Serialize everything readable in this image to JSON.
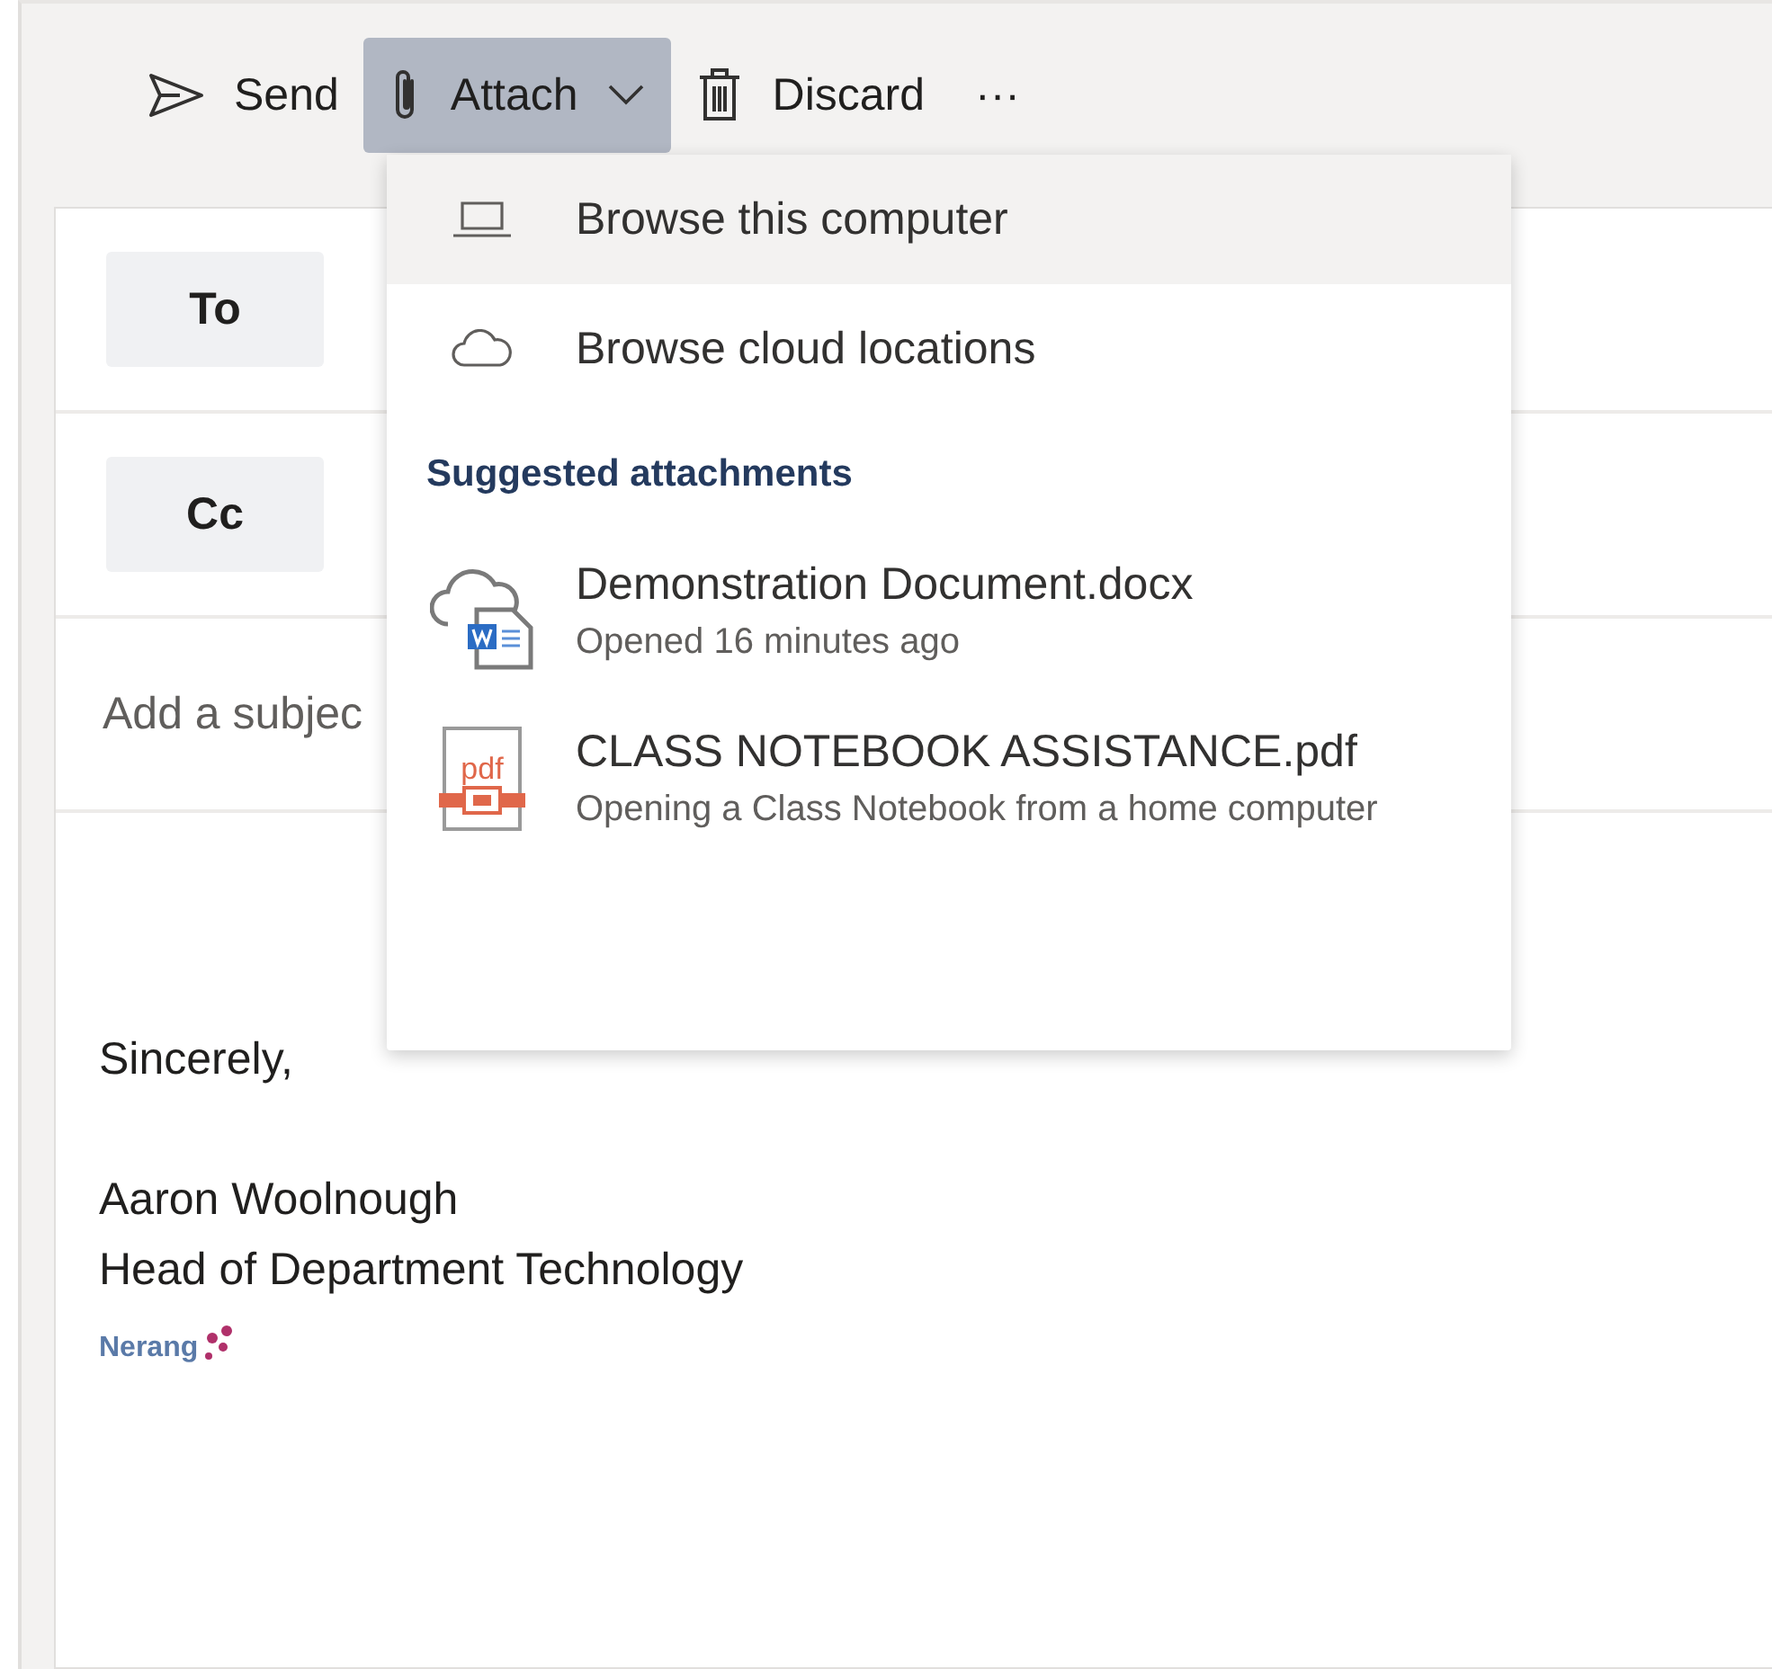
{
  "toolbar": [
    {
      "kind": "send",
      "label": "Send",
      "expanded": false
    },
    {
      "kind": "attach",
      "label": "Attach",
      "expanded": true
    },
    {
      "kind": "discard",
      "label": "Discard",
      "expanded": false
    },
    {
      "kind": "more",
      "label": "···",
      "expanded": false
    }
  ],
  "recipients": [
    {
      "label": "To"
    },
    {
      "label": "Cc"
    }
  ],
  "subject": {
    "placeholder": "Add a subjec"
  },
  "body": {
    "closing": "Sincerely,",
    "name": "Aaron Woolnough",
    "title": "Head of Department Technology",
    "logo_text": "Nerang"
  },
  "attach_menu": {
    "items": [
      {
        "kind": "computer",
        "label": "Browse this computer",
        "selected": true
      },
      {
        "kind": "cloud",
        "label": "Browse cloud locations",
        "selected": false
      }
    ],
    "suggested_heading": "Suggested attachments",
    "suggested": [
      {
        "kind": "word",
        "name": "Demonstration Document.docx",
        "detail": "Opened 16 minutes ago"
      },
      {
        "kind": "pdf",
        "name": "CLASS NOTEBOOK ASSISTANCE.pdf",
        "detail": "Opening a Class Notebook from a home computer"
      }
    ]
  }
}
